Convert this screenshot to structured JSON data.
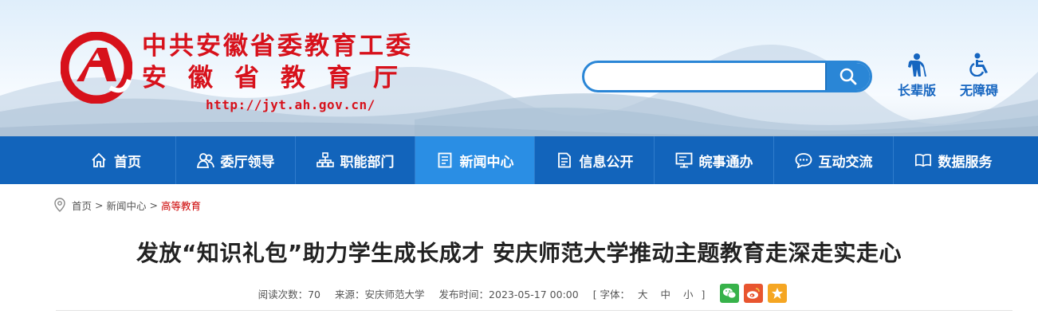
{
  "header": {
    "title_line1": "中共安徽省委教育工委",
    "title_line2": "安徽省教育厅",
    "url": "http://jyt.ah.gov.cn/",
    "search": {
      "value": "",
      "placeholder": ""
    },
    "tools": [
      {
        "label": "长辈版",
        "icon": "elder-icon"
      },
      {
        "label": "无障碍",
        "icon": "wheelchair-icon"
      }
    ],
    "colors": {
      "brand_red": "#d7111b",
      "accent_blue": "#2a86d6"
    }
  },
  "nav": {
    "items": [
      {
        "label": "首页",
        "icon": "home-icon"
      },
      {
        "label": "委厅领导",
        "icon": "people-icon"
      },
      {
        "label": "职能部门",
        "icon": "org-chart-icon"
      },
      {
        "label": "新闻中心",
        "icon": "news-icon",
        "active": true
      },
      {
        "label": "信息公开",
        "icon": "document-icon"
      },
      {
        "label": "皖事通办",
        "icon": "monitor-icon"
      },
      {
        "label": "互动交流",
        "icon": "chat-icon"
      },
      {
        "label": "数据服务",
        "icon": "book-icon"
      }
    ],
    "colors": {
      "bar": "#1264bb",
      "active": "#2a8ee4"
    }
  },
  "breadcrumb": {
    "items": [
      "首页",
      "新闻中心",
      "高等教育"
    ],
    "separator": ">"
  },
  "article": {
    "title": "发放“知识礼包”助力学生成长成才 安庆师范大学推动主题教育走深走实走心",
    "views_label": "阅读次数：",
    "views": "70",
    "source_label": "来源：",
    "source": "安庆师范大学",
    "published_label": "发布时间：",
    "published": "2023-05-17 00:00",
    "font_label": "[ 字体：",
    "font_sizes": [
      "大",
      "中",
      "小"
    ],
    "font_close": "]",
    "share": [
      {
        "name": "wechat",
        "icon": "wechat-icon",
        "color": "#37b24a"
      },
      {
        "name": "weibo",
        "icon": "weibo-icon",
        "color": "#e8552f"
      },
      {
        "name": "favorite",
        "icon": "star-icon",
        "color": "#f5a623"
      }
    ]
  }
}
